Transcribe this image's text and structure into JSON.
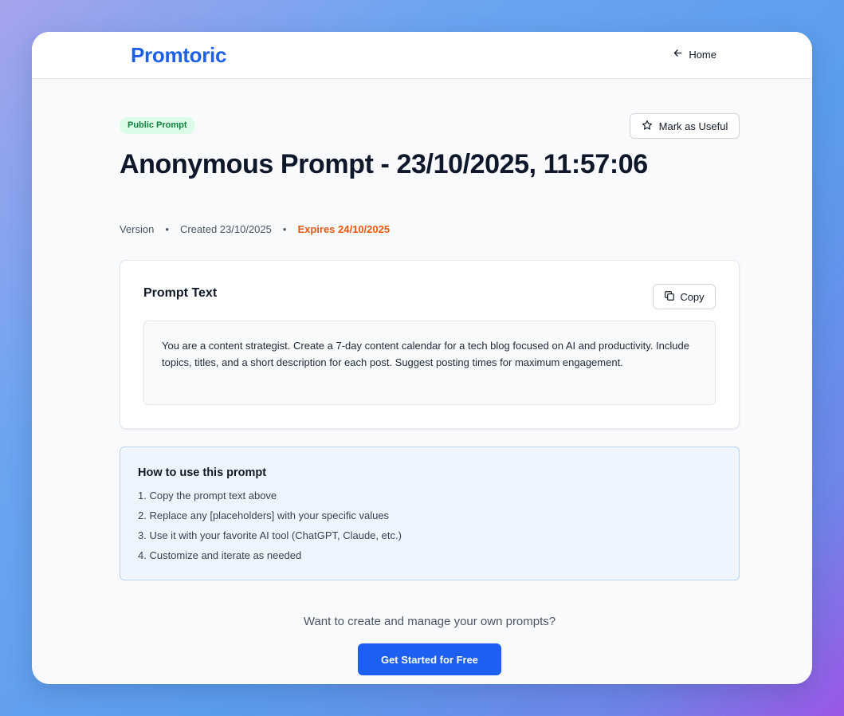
{
  "header": {
    "brand": "Promtoric",
    "home_label": "Home"
  },
  "prompt": {
    "badge": "Public Prompt",
    "mark_useful_label": "Mark as Useful",
    "title": "Anonymous Prompt - 23/10/2025, 11:57:06",
    "meta": {
      "version": "Version",
      "created": "Created 23/10/2025",
      "expires": "Expires 24/10/2025"
    }
  },
  "prompt_card": {
    "title": "Prompt Text",
    "copy_label": "Copy",
    "text": "You are a content strategist. Create a 7-day content calendar for a tech blog focused on AI and productivity. Include topics, titles, and a short description for each post. Suggest posting times for maximum engagement."
  },
  "howto": {
    "title": "How to use this prompt",
    "steps": [
      "1. Copy the prompt text above",
      "2. Replace any [placeholders] with your specific values",
      "3. Use it with your favorite AI tool (ChatGPT, Claude, etc.)",
      "4. Customize and iterate as needed"
    ]
  },
  "cta": {
    "text": "Want to create and manage your own prompts?",
    "button_label": "Get Started for Free"
  },
  "colors": {
    "brand": "#1f5fe6",
    "badge_bg": "#dcfce7",
    "badge_text": "#15803d",
    "expires": "#ea580c",
    "cta_button": "#1d5ff0"
  },
  "icons": {
    "home": "arrow-left-icon",
    "useful": "star-icon",
    "copy": "copy-icon"
  }
}
